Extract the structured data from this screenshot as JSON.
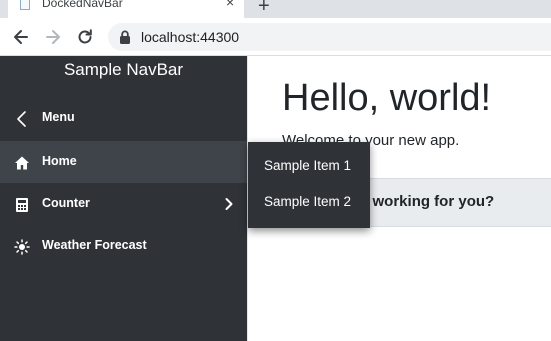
{
  "browser": {
    "tab_title": "DockedNavBar",
    "close_glyph": "×",
    "new_tab_glyph": "+",
    "url": "localhost:44300"
  },
  "sidebar": {
    "title": "Sample NavBar",
    "items": [
      {
        "label": "Menu",
        "icon": "back-chevron-icon"
      },
      {
        "label": "Home",
        "icon": "home-icon",
        "active": true
      },
      {
        "label": "Counter",
        "icon": "calculator-icon",
        "has_submenu": true
      },
      {
        "label": "Weather Forecast",
        "icon": "sun-icon"
      }
    ]
  },
  "flyout": {
    "items": [
      {
        "label": "Sample Item 1"
      },
      {
        "label": "Sample Item 2"
      }
    ]
  },
  "main": {
    "heading": "Hello, world!",
    "subtitle": "Welcome to your new app.",
    "survey_text": "How is Blazor working for you?"
  },
  "colors": {
    "sidebar_bg": "#2f3338",
    "sidebar_active_bg": "#3f444a",
    "survey_bg": "#e9ecef"
  }
}
